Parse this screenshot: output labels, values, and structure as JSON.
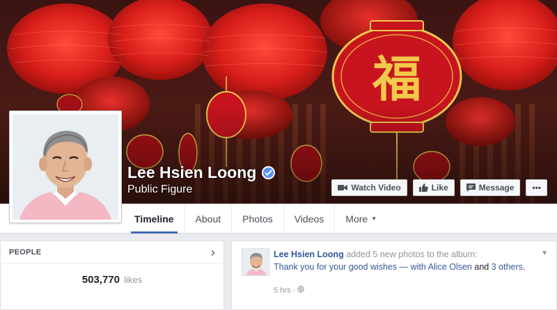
{
  "page": {
    "name": "Lee Hsien Loong",
    "category": "Public Figure"
  },
  "actions": {
    "watch_video": "Watch Video",
    "like": "Like",
    "message": "Message",
    "more": "•••"
  },
  "nav": {
    "tabs": [
      {
        "label": "Timeline",
        "active": true
      },
      {
        "label": "About"
      },
      {
        "label": "Photos"
      },
      {
        "label": "Videos"
      },
      {
        "label": "More"
      }
    ]
  },
  "people": {
    "title": "PEOPLE",
    "likes_count": "503,770",
    "likes_label": "likes"
  },
  "post": {
    "author": "Lee Hsien Loong",
    "action": "added 5 new photos to the album:",
    "album_prefix": "Thank you for your good wishes — with",
    "tagged": "Alice Olsen",
    "and": "and",
    "others": "3 others",
    "period": ".",
    "time": "5 hrs",
    "separator": "·"
  },
  "colors": {
    "link": "#365899",
    "accent": "#4267b2",
    "cover_red": "#c8141e",
    "lantern_gold": "#f2c94c"
  },
  "cover_text": {
    "fu": "福"
  },
  "icons": [
    "video-camera-icon",
    "thumbs-up-icon",
    "message-icon",
    "verified-badge-icon",
    "globe-icon",
    "chevron-right-icon"
  ]
}
